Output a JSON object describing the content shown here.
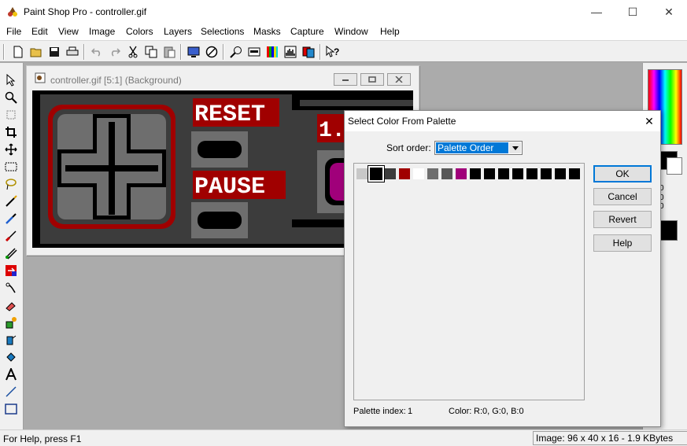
{
  "window": {
    "title": "Paint Shop Pro - controller.gif",
    "minimize": "—",
    "maximize": "☐",
    "close": "✕"
  },
  "menu": [
    "File",
    "Edit",
    "View",
    "Image",
    "Colors",
    "Layers",
    "Selections",
    "Masks",
    "Capture",
    "Window",
    "Help"
  ],
  "image_window": {
    "title": "controller.gif [5:1] (Background)",
    "artwork": {
      "reset": "RESET",
      "pause": "PAUSE",
      "badge": "1."
    }
  },
  "dialog": {
    "title": "Select Color From Palette",
    "close": "✕",
    "sort_label": "Sort order:",
    "sort_value": "Palette Order",
    "buttons": {
      "ok": "OK",
      "cancel": "Cancel",
      "revert": "Revert",
      "help": "Help"
    },
    "palette_index_label": "Palette index:",
    "palette_index_value": "1",
    "color_label": "Color:",
    "color_value": "R:0, G:0, B:0",
    "swatches": [
      "#c8c8c8",
      "#000000",
      "#3c3c3c",
      "#a00000",
      "#ffffff",
      "#6e6e6e",
      "#585858",
      "#a0007a",
      "#000000",
      "#000000",
      "#000000",
      "#000000",
      "#000000",
      "#000000",
      "#000000",
      "#000000"
    ],
    "selected_index": 1
  },
  "status": {
    "help": "For Help, press F1",
    "image_info": "Image:  96 x 40 x 16 - 1.9 KBytes"
  },
  "colors": {
    "art_bg": "#000000",
    "art_body": "#3c3c3c",
    "art_red": "#a00000",
    "art_gray": "#6e6e6e",
    "art_magenta": "#a0007a",
    "dropdown_selected": "#0078d7"
  },
  "right_panel": {
    "fragment_a": "0",
    "fragment_b": "0",
    "fragment_c": "0"
  }
}
